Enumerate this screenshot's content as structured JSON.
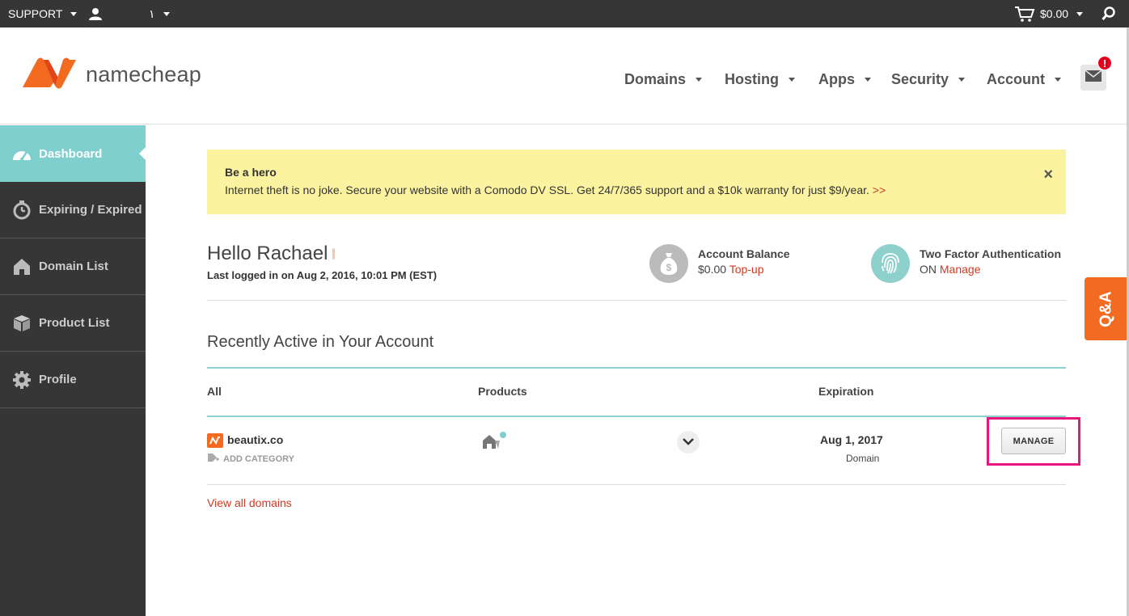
{
  "topbar": {
    "support_label": "SUPPORT",
    "user_label": "١",
    "cart_amount": "$0.00"
  },
  "header": {
    "logo_text": "namecheap",
    "nav": [
      {
        "label": "Domains"
      },
      {
        "label": "Hosting"
      },
      {
        "label": "Apps"
      },
      {
        "label": "Security"
      },
      {
        "label": "Account"
      }
    ],
    "mail_badge": "!"
  },
  "sidebar": {
    "items": [
      {
        "label": "Dashboard",
        "icon": "speedometer-icon",
        "active": true
      },
      {
        "label": "Expiring / Expired",
        "icon": "stopwatch-icon"
      },
      {
        "label": "Domain List",
        "icon": "house-icon"
      },
      {
        "label": "Product List",
        "icon": "box-icon"
      },
      {
        "label": "Profile",
        "icon": "gear-icon"
      }
    ]
  },
  "banner": {
    "title": "Be a hero",
    "text": "Internet theft is no joke. Secure your website with a Comodo DV SSL. Get 24/7/365 support and a $10k warranty for just $9/year.",
    "link": ">>",
    "close": "×"
  },
  "greeting": {
    "hello": "Hello Rachael",
    "last_login": "Last logged in on Aug 2, 2016, 10:01 PM (EST)"
  },
  "balance": {
    "title": "Account Balance",
    "amount": "$0.00",
    "link": "Top-up"
  },
  "two_factor": {
    "title": "Two Factor Authentication",
    "status": "ON",
    "link": "Manage"
  },
  "recent": {
    "title": "Recently Active in Your Account",
    "columns": {
      "all": "All",
      "products": "Products",
      "expiration": "Expiration"
    },
    "rows": [
      {
        "domain": "beautix.co",
        "add_category": "ADD CATEGORY",
        "expiration_date": "Aug 1, 2017",
        "expiration_type": "Domain",
        "manage_label": "MANAGE"
      }
    ],
    "view_all": "View all domains"
  },
  "qa_tab": "Q&A",
  "colors": {
    "accent_teal": "#7fcfcf",
    "brand_orange": "#f26b21",
    "link_red": "#d13a1f",
    "highlight_pink": "#e8167e",
    "banner_yellow": "#fbf3a0",
    "sidebar_dark": "#363636"
  }
}
